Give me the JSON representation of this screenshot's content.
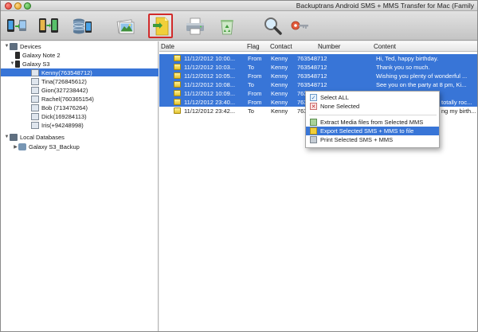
{
  "window": {
    "title": "Backuptrans Android SMS + MMS Transfer for Mac (Family"
  },
  "toolbar": {
    "buttons": [
      {
        "name": "transfer-phone-to-computer",
        "icon": "phone-to-computer-icon"
      },
      {
        "name": "transfer-phone-to-phone",
        "icon": "phone-to-phone-icon"
      },
      {
        "name": "database",
        "icon": "database-icon"
      },
      {
        "name": "mms-media",
        "icon": "photos-icon"
      },
      {
        "name": "export",
        "icon": "export-file-icon"
      },
      {
        "name": "print",
        "icon": "printer-icon"
      },
      {
        "name": "recycle",
        "icon": "recycle-icon"
      },
      {
        "name": "search",
        "icon": "magnifier-icon"
      },
      {
        "name": "register",
        "icon": "key-icon"
      }
    ]
  },
  "tree": {
    "devices_label": "Devices",
    "galaxy_note_label": "Galaxy Note 2",
    "galaxy_s3_label": "Galaxy S3",
    "contacts": [
      "Kenny(763548712)",
      "Tina(726845612)",
      "Gion(327238442)",
      "Rachel(760365154)",
      "Bob (713476264)",
      "Dick(169284113)",
      "Iris(+94248998)"
    ],
    "local_db_label": "Local Databases",
    "backup_label": "Galaxy S3_Backup"
  },
  "table": {
    "headers": {
      "date": "Date",
      "flag": "Flag",
      "contact": "Contact",
      "number": "Number",
      "content": "Content"
    },
    "rows": [
      {
        "date": "11/12/2012 10:00...",
        "flag": "From",
        "contact": "Kenny",
        "number": "763548712",
        "content": "Hi, Ted, happy birthday.",
        "selected": true
      },
      {
        "date": "11/12/2012 10:03...",
        "flag": "To",
        "contact": "Kenny",
        "number": "763548712",
        "content": "Thank you so much.",
        "selected": true
      },
      {
        "date": "11/12/2012 10:05...",
        "flag": "From",
        "contact": "Kenny",
        "number": "763548712",
        "content": "Wishing you plenty of wonderful ...",
        "selected": true
      },
      {
        "date": "11/12/2012 10:08...",
        "flag": "To",
        "contact": "Kenny",
        "number": "763548712",
        "content": "See you on the party at 8 pm, Ki...",
        "selected": true
      },
      {
        "date": "11/12/2012 10:09...",
        "flag": "From",
        "contact": "Kenny",
        "number": "763548712",
        "content": "",
        "selected": true
      },
      {
        "date": "11/12/2012 23:40...",
        "flag": "From",
        "contact": "Kenny",
        "number": "763548712",
        "content": "totally roc...",
        "selected": true
      },
      {
        "date": "11/12/2012 23:42...",
        "flag": "To",
        "contact": "Kenny",
        "number": "763548712",
        "content": "ng my birth...",
        "selected": false
      }
    ]
  },
  "context_menu": {
    "select_all": "Select ALL",
    "none_selected": "None Selected",
    "extract_media": "Extract Media files from Selected MMS",
    "export_selected": "Export Selected SMS + MMS to file",
    "print_selected": "Print Selected SMS + MMS"
  },
  "colors": {
    "selection": "#3875d7",
    "active_toolbar_border": "#d12a2a"
  }
}
